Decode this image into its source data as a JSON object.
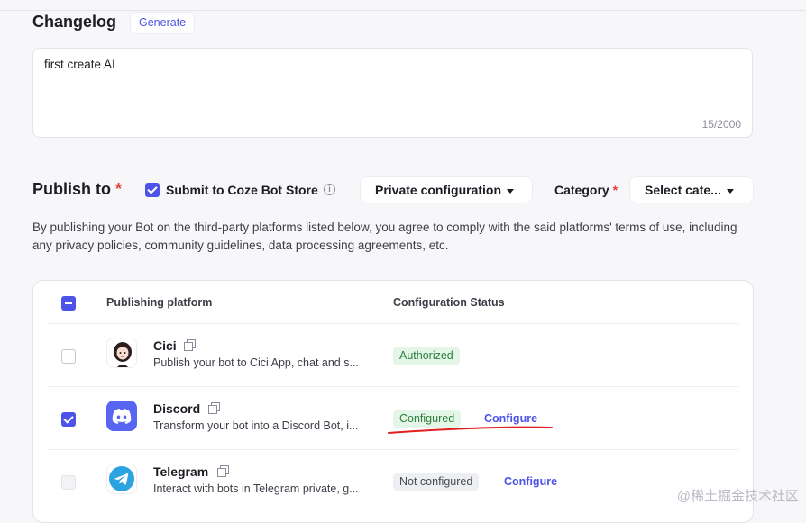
{
  "changelog": {
    "title": "Changelog",
    "generate_label": "Generate",
    "value": "first create AI",
    "char_count": "15/2000"
  },
  "publish": {
    "title": "Publish to",
    "required_mark": "*",
    "store_checkbox_label": "Submit to Coze Bot Store",
    "store_checked": true,
    "info_icon": "i",
    "private_config_label": "Private configuration",
    "category_label": "Category",
    "category_placeholder": "Select cate...",
    "notice": "By publishing your Bot on the third-party platforms listed below, you agree to comply with the said platforms' terms of use, including any privacy policies, community guidelines, data processing agreements, etc."
  },
  "table": {
    "headers": {
      "platform": "Publishing platform",
      "status": "Configuration Status"
    },
    "rows": [
      {
        "name": "Cici",
        "description": "Publish your bot to Cici App, chat and s...",
        "status": "Authorized",
        "status_color": "green",
        "checked": false,
        "icon": "cici-avatar-icon"
      },
      {
        "name": "Discord",
        "description": "Transform your bot into a Discord Bot, i...",
        "status": "Configured",
        "status_color": "green",
        "configure_label": "Configure",
        "checked": true,
        "icon": "discord-logo-icon"
      },
      {
        "name": "Telegram",
        "description": "Interact with bots in Telegram private, g...",
        "status": "Not configured",
        "status_color": "gray",
        "configure_label": "Configure",
        "checked": false,
        "disabled": true,
        "icon": "telegram-logo-icon"
      }
    ]
  },
  "colors": {
    "accent": "#4d53e8",
    "annotation": "#e02020"
  },
  "watermark": "@稀土掘金技术社区"
}
